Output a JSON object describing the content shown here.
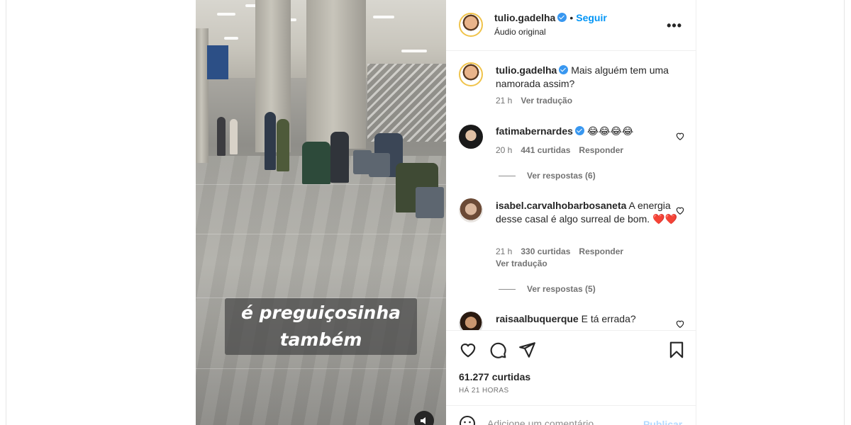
{
  "video": {
    "caption_line1": "é preguiçosinha",
    "caption_line2": "também",
    "sound_icon": "speaker-icon"
  },
  "header": {
    "username": "tulio.gadelha",
    "separator": "•",
    "follow_label": "Seguir",
    "audio_label": "Áudio original",
    "more_icon": "more-horizontal-icon"
  },
  "caption": {
    "username": "tulio.gadelha",
    "text": "Mais alguém tem uma namorada assim?",
    "time": "21 h",
    "translate_label": "Ver tradução"
  },
  "comments": [
    {
      "username": "fatimabernardes",
      "verified": true,
      "text": "😂😂😂😂",
      "time": "20 h",
      "likes": "441 curtidas",
      "reply_label": "Responder",
      "view_replies": "Ver respostas (6)"
    },
    {
      "username": "isabel.carvalhobarbosaneta",
      "verified": false,
      "text": "A energia desse casal é algo surreal de bom. ❤️❤️",
      "time": "21 h",
      "likes": "330 curtidas",
      "reply_label": "Responder",
      "translate_label": "Ver tradução",
      "view_replies": "Ver respostas (5)"
    },
    {
      "username": "raisaalbuquerque",
      "verified": false,
      "text": "E tá errada?"
    }
  ],
  "actions": {
    "like_icon": "heart-icon",
    "comment_icon": "comment-icon",
    "share_icon": "send-icon",
    "save_icon": "bookmark-icon",
    "likes_count": "61.277 curtidas",
    "time_ago": "HÁ 21 HORAS"
  },
  "comment_box": {
    "placeholder": "Adicione um comentário...",
    "publish_label": "Publicar",
    "emoji_icon": "emoji-icon"
  },
  "colors": {
    "link_blue": "#0095f6",
    "verified_blue": "#3897f0",
    "muted_text": "#737373",
    "publish_disabled": "#b3dbff"
  }
}
